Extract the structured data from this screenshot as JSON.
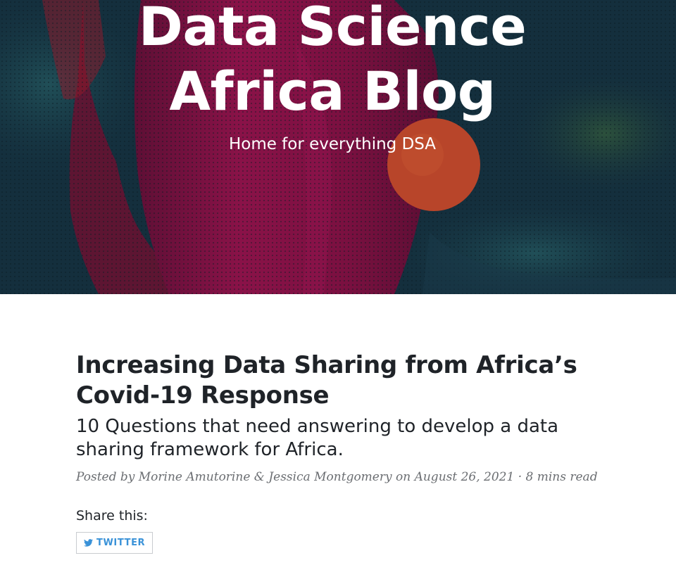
{
  "hero": {
    "title_line1": "Data Science",
    "title_line2": "Africa Blog",
    "subtitle": "Home for everything DSA"
  },
  "post": {
    "title": "Increasing Data Sharing from Africa’s Covid-19 Response",
    "subtitle": "10 Questions that need answering to develop a data sharing framework for Africa.",
    "meta": "Posted by Morine Amutorine & Jessica Montgomery on August 26, 2021 · 8 mins read"
  },
  "share": {
    "label": "Share this:",
    "twitter_label": "TWITTER",
    "twitter_icon": "twitter-bird-icon"
  },
  "colors": {
    "hero_magenta": "#7a1040",
    "hero_teal": "#13303f",
    "hero_orange": "#b8452a",
    "text_dark": "#1f2328",
    "meta_gray": "#6b6e72",
    "twitter_blue": "#3a92d8"
  }
}
